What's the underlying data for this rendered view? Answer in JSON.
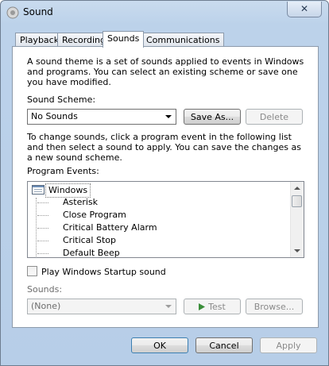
{
  "window": {
    "title": "Sound",
    "close_glyph": "✕"
  },
  "tabs": [
    {
      "label": "Playback",
      "active": false
    },
    {
      "label": "Recording",
      "active": false
    },
    {
      "label": "Sounds",
      "active": true
    },
    {
      "label": "Communications",
      "active": false
    }
  ],
  "sounds_tab": {
    "intro_text": "A sound theme is a set of sounds applied to events in Windows and programs.  You can select an existing scheme or save one you have modified.",
    "scheme_label": "Sound Scheme:",
    "scheme_value": "No Sounds",
    "save_as_label": "Save As...",
    "delete_label": "Delete",
    "instructions_text": "To change sounds, click a program event in the following list and then select a sound to apply.  You can save the changes as a new sound scheme.",
    "program_events_label": "Program Events:",
    "events_root": "Windows",
    "events": [
      "Asterisk",
      "Close Program",
      "Critical Battery Alarm",
      "Critical Stop",
      "Default Beep"
    ],
    "startup_checkbox_label": "Play Windows Startup sound",
    "startup_checked": false,
    "sounds_label": "Sounds:",
    "sound_value": "(None)",
    "test_label": "Test",
    "browse_label": "Browse..."
  },
  "footer": {
    "ok_label": "OK",
    "cancel_label": "Cancel",
    "apply_label": "Apply"
  },
  "colors": {
    "frame": "#b7cee8",
    "test_icon": "#3a8e3a"
  }
}
